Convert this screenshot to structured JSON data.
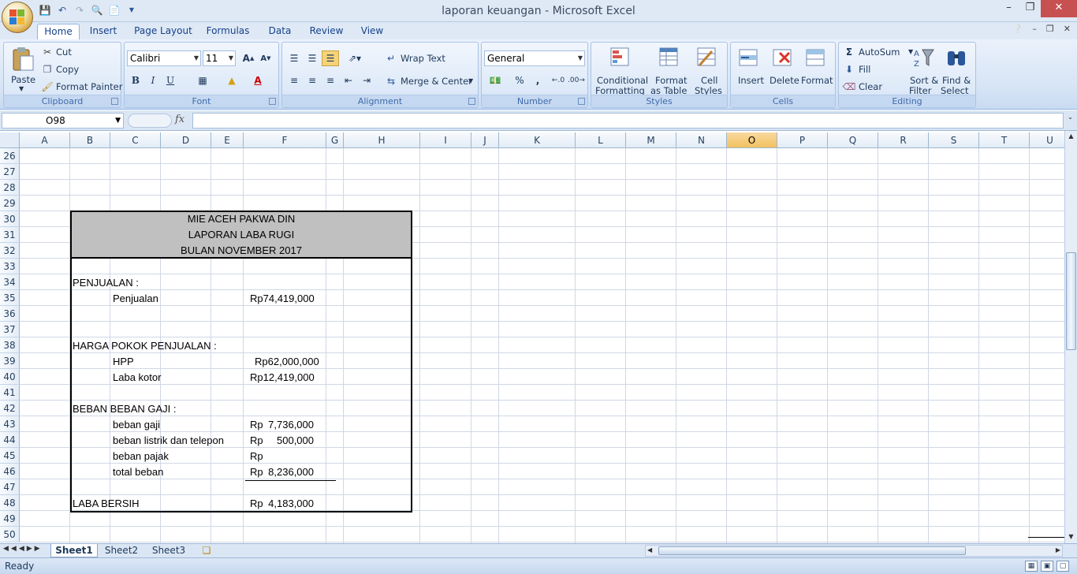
{
  "window": {
    "title": "laporan keuangan - Microsoft Excel"
  },
  "ribbon_tabs": [
    "Home",
    "Insert",
    "Page Layout",
    "Formulas",
    "Data",
    "Review",
    "View"
  ],
  "clipboard": {
    "paste": "Paste",
    "cut": "Cut",
    "copy": "Copy",
    "format_painter": "Format Painter",
    "label": "Clipboard"
  },
  "font": {
    "name": "Calibri",
    "size": "11",
    "bold": "B",
    "italic": "I",
    "underline": "U",
    "label": "Font"
  },
  "alignment": {
    "wrap_text": "Wrap Text",
    "merge_center": "Merge & Center",
    "label": "Alignment"
  },
  "number": {
    "format": "General",
    "percent": "%",
    "comma": ",",
    "label": "Number"
  },
  "styles": {
    "conditional_1": "Conditional",
    "conditional_2": "Formatting",
    "format_table_1": "Format",
    "format_table_2": "as Table",
    "cell_styles_1": "Cell",
    "cell_styles_2": "Styles",
    "label": "Styles"
  },
  "cells": {
    "insert": "Insert",
    "delete": "Delete",
    "format": "Format",
    "label": "Cells"
  },
  "editing": {
    "autosum": "AutoSum",
    "fill": "Fill",
    "clear": "Clear",
    "sort_1": "Sort &",
    "sort_2": "Filter",
    "find_1": "Find &",
    "find_2": "Select",
    "label": "Editing"
  },
  "formula_bar": {
    "name_box": "O98",
    "fx": "fx",
    "value": ""
  },
  "columns": [
    "A",
    "B",
    "C",
    "D",
    "E",
    "F",
    "G",
    "H",
    "I",
    "J",
    "K",
    "L",
    "M",
    "N",
    "O",
    "P",
    "Q",
    "R",
    "S",
    "T",
    "U"
  ],
  "selected_column": "O",
  "rows": [
    "26",
    "27",
    "28",
    "29",
    "30",
    "31",
    "32",
    "33",
    "34",
    "35",
    "36",
    "37",
    "38",
    "39",
    "40",
    "41",
    "42",
    "43",
    "44",
    "45",
    "46",
    "47",
    "48",
    "49",
    "50"
  ],
  "report": {
    "title1": "MIE ACEH PAKWA DIN",
    "title2": "LAPORAN LABA RUGI",
    "title3": "BULAN NOVEMBER 2017",
    "sec_penjualan": "PENJUALAN :",
    "penjualan": "Penjualan",
    "penjualan_val": "Rp74,419,000",
    "sec_hpp": "HARGA POKOK PENJUALAN :",
    "hpp": "HPP",
    "hpp_val": "Rp62,000,000",
    "laba_kotor": "Laba kotor",
    "laba_kotor_val": "Rp12,419,000",
    "sec_beban": "BEBAN BEBAN GAJI :",
    "beban_gaji": "beban gaji",
    "beban_gaji_rp": "Rp",
    "beban_gaji_val": "7,736,000",
    "beban_listrik": "beban listrik dan telepon",
    "beban_listrik_rp": "Rp",
    "beban_listrik_val": "500,000",
    "beban_pajak": "beban pajak",
    "beban_pajak_rp": "Rp",
    "total_beban": "total beban",
    "total_beban_rp": "Rp",
    "total_beban_val": "8,236,000",
    "laba_bersih": "LABA BERSIH",
    "laba_bersih_rp": "Rp",
    "laba_bersih_val": "4,183,000"
  },
  "sheets": [
    "Sheet1",
    "Sheet2",
    "Sheet3"
  ],
  "active_sheet": "Sheet1",
  "status": {
    "ready": "Ready"
  },
  "colors": {
    "accent": "#15428b",
    "header_fill": "#c0c0c0",
    "selected_col": "#f5c766"
  }
}
